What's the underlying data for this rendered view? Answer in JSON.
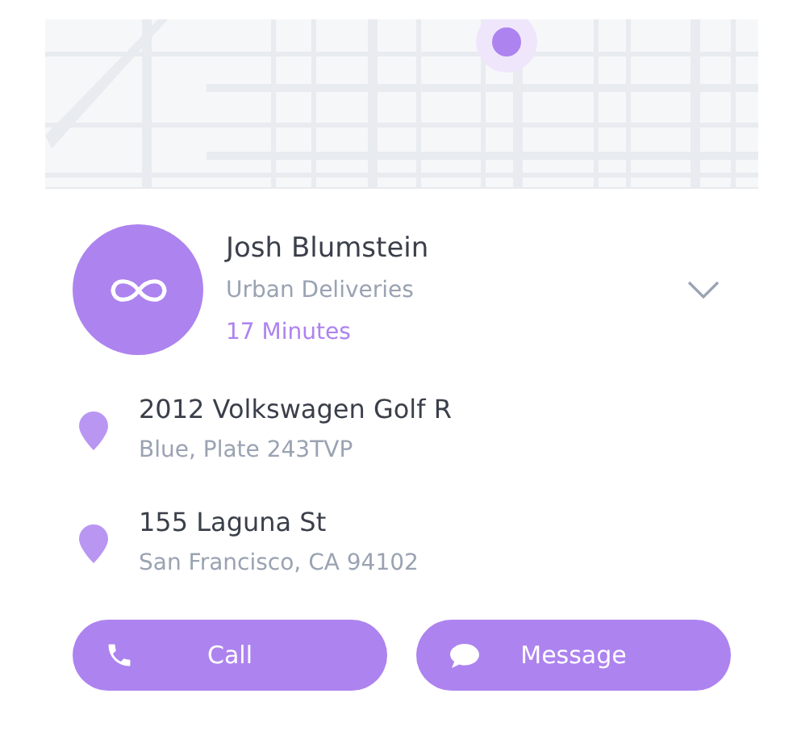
{
  "driver": {
    "name": "Josh Blumstein",
    "company": "Urban Deliveries",
    "eta": "17 Minutes"
  },
  "details": [
    {
      "title": "2012 Volkswagen Golf R",
      "subtitle": "Blue, Plate 243TVP"
    },
    {
      "title": "155 Laguna St",
      "subtitle": "San Francisco, CA 94102"
    }
  ],
  "actions": [
    {
      "kind": "call",
      "label": "Call"
    },
    {
      "kind": "message",
      "label": "Message"
    }
  ]
}
